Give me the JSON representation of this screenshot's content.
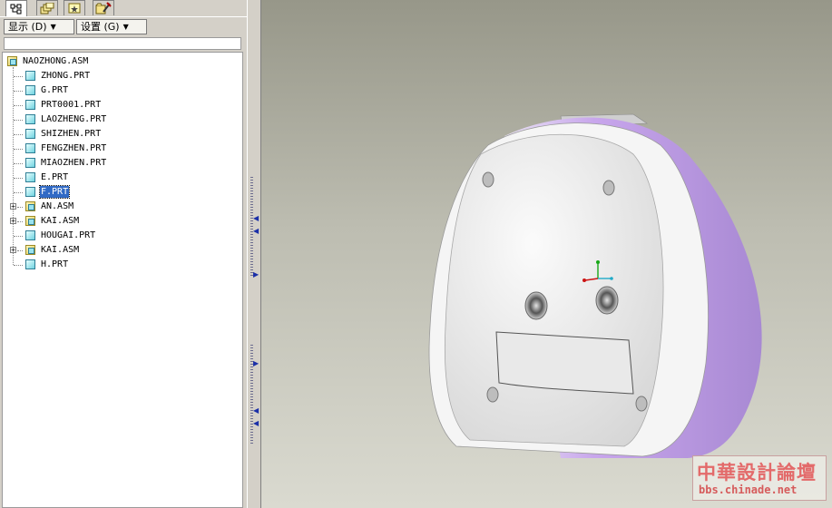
{
  "toolbar": {
    "show_menu_label": "显示 (D)",
    "settings_menu_label": "设置 (G)"
  },
  "model_tree": {
    "root": {
      "name": "NAOZHONG.ASM",
      "type": "assembly"
    },
    "items": [
      {
        "name": "ZHONG.PRT",
        "type": "part",
        "expandable": false,
        "selected": false
      },
      {
        "name": "G.PRT",
        "type": "part",
        "expandable": false,
        "selected": false
      },
      {
        "name": "PRT0001.PRT",
        "type": "part",
        "expandable": false,
        "selected": false
      },
      {
        "name": "LAOZHENG.PRT",
        "type": "part",
        "expandable": false,
        "selected": false
      },
      {
        "name": "SHIZHEN.PRT",
        "type": "part",
        "expandable": false,
        "selected": false
      },
      {
        "name": "FENGZHEN.PRT",
        "type": "part",
        "expandable": false,
        "selected": false
      },
      {
        "name": "MIAOZHEN.PRT",
        "type": "part",
        "expandable": false,
        "selected": false
      },
      {
        "name": "E.PRT",
        "type": "part",
        "expandable": false,
        "selected": false
      },
      {
        "name": "F.PRT",
        "type": "part",
        "expandable": false,
        "selected": true
      },
      {
        "name": "AN.ASM",
        "type": "assembly",
        "expandable": true,
        "selected": false
      },
      {
        "name": "KAI.ASM",
        "type": "assembly",
        "expandable": true,
        "selected": false
      },
      {
        "name": "HOUGAI.PRT",
        "type": "part",
        "expandable": false,
        "selected": false
      },
      {
        "name": "KAI.ASM",
        "type": "assembly",
        "expandable": true,
        "selected": false
      },
      {
        "name": "H.PRT",
        "type": "part",
        "expandable": false,
        "selected": false
      }
    ]
  },
  "icons": {
    "tab_1": "model-tree-icon",
    "tab_2": "layers-icon",
    "tab_3": "favorites-icon",
    "tab_4": "folder-browser-icon"
  },
  "colors": {
    "selection": "#316ac5",
    "model_body": "#f2f2f2",
    "model_side": "#c6a4ea",
    "background_top": "#979789",
    "background_bottom": "#dadad0"
  },
  "watermark": {
    "title": "中華設計論壇",
    "url": "bbs.chinade.net"
  }
}
